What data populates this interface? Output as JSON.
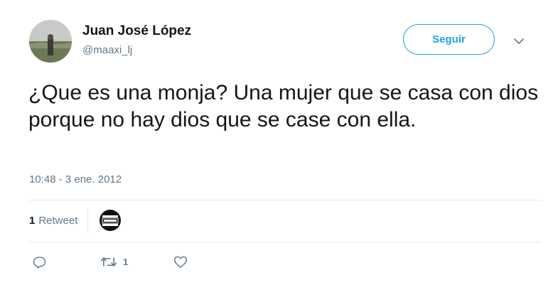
{
  "author": {
    "name": "Juan José López",
    "handle": "@maaxi_lj",
    "avatar_icon": "profile-photo"
  },
  "follow_button": {
    "label": "Seguir"
  },
  "menu": {
    "icon": "chevron-down-icon"
  },
  "tweet": {
    "text": "¿Que es una monja? Una mujer que se casa con dios porque no hay dios que se case con ella.",
    "timestamp": "10:48 - 3 ene. 2012"
  },
  "stats": {
    "retweet_count": "1",
    "retweet_label": "Retweet",
    "retweeter_avatar_icon": "parental-advisory-logo"
  },
  "actions": {
    "reply": {
      "icon": "reply-icon"
    },
    "retweet": {
      "icon": "retweet-icon",
      "count": "1"
    },
    "like": {
      "icon": "heart-icon"
    }
  },
  "colors": {
    "accent": "#1da1f2",
    "text": "#14171a",
    "secondary_text": "#657786",
    "divider": "#e6ecf0"
  }
}
